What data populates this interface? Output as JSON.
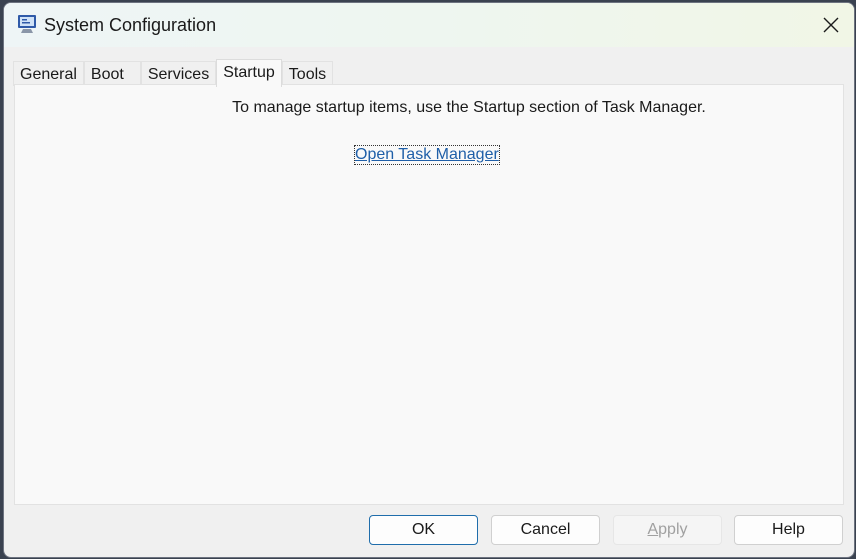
{
  "window": {
    "title": "System Configuration",
    "app_icon": "msconfig-computer-icon",
    "close_icon": "close-icon"
  },
  "tabs": [
    {
      "label": "General",
      "active": false
    },
    {
      "label": "Boot",
      "active": false
    },
    {
      "label": "Services",
      "active": false
    },
    {
      "label": "Startup",
      "active": true
    },
    {
      "label": "Tools",
      "active": false
    }
  ],
  "startup_panel": {
    "message": "To manage startup items, use the Startup section of Task Manager.",
    "link_label": "Open Task Manager"
  },
  "buttons": {
    "ok": "OK",
    "cancel": "Cancel",
    "apply_first": "A",
    "apply_rest": "pply",
    "apply_enabled": false,
    "help": "Help"
  },
  "colors": {
    "link": "#1f5fa8",
    "ok_border": "#1f6dab"
  }
}
